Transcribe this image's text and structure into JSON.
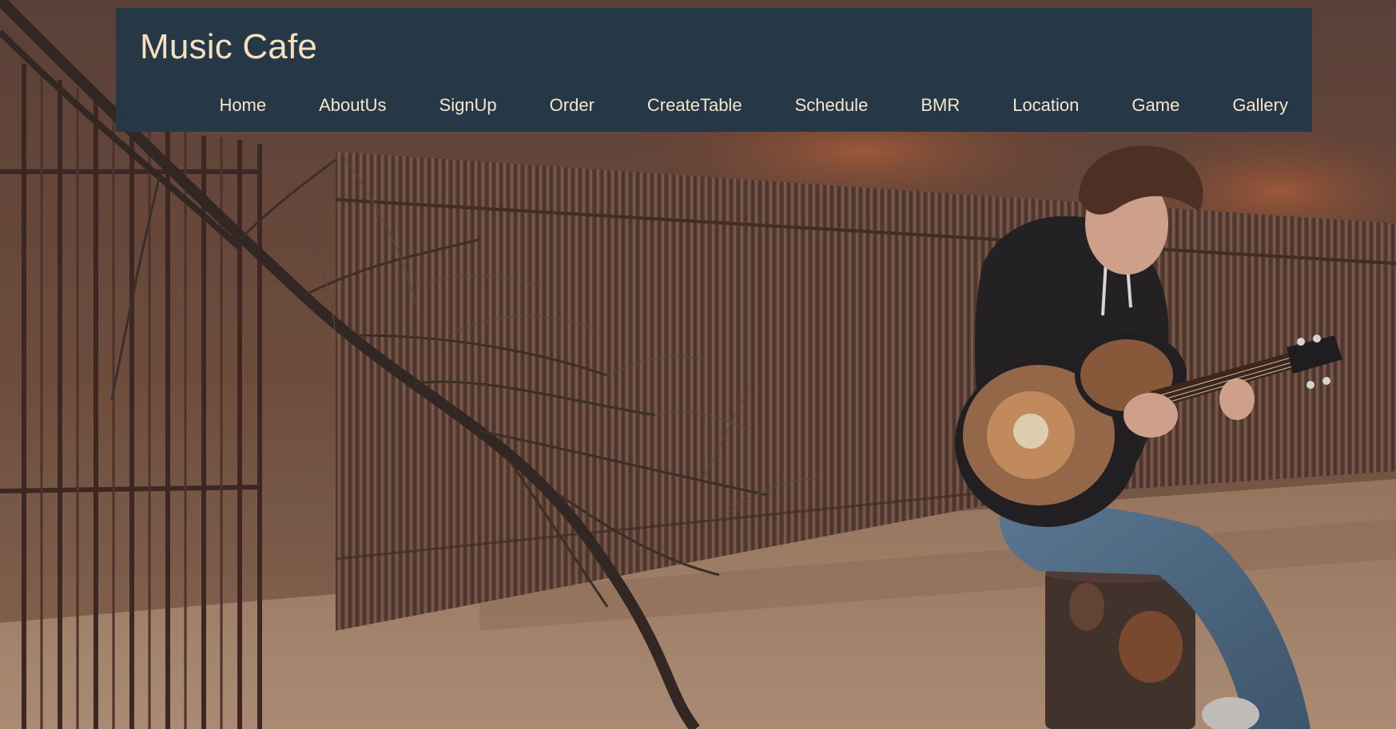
{
  "header": {
    "brand": "Music Cafe"
  },
  "nav": {
    "items": [
      {
        "label": "Home"
      },
      {
        "label": "AboutUs"
      },
      {
        "label": "SignUp"
      },
      {
        "label": "Order"
      },
      {
        "label": "CreateTable"
      },
      {
        "label": "Schedule"
      },
      {
        "label": "BMR"
      },
      {
        "label": "Location"
      },
      {
        "label": "Game"
      },
      {
        "label": "Gallery"
      }
    ]
  },
  "colors": {
    "header_bg": "#263745",
    "brand_text": "#f5e0c0",
    "nav_text": "#f5e6d0"
  }
}
